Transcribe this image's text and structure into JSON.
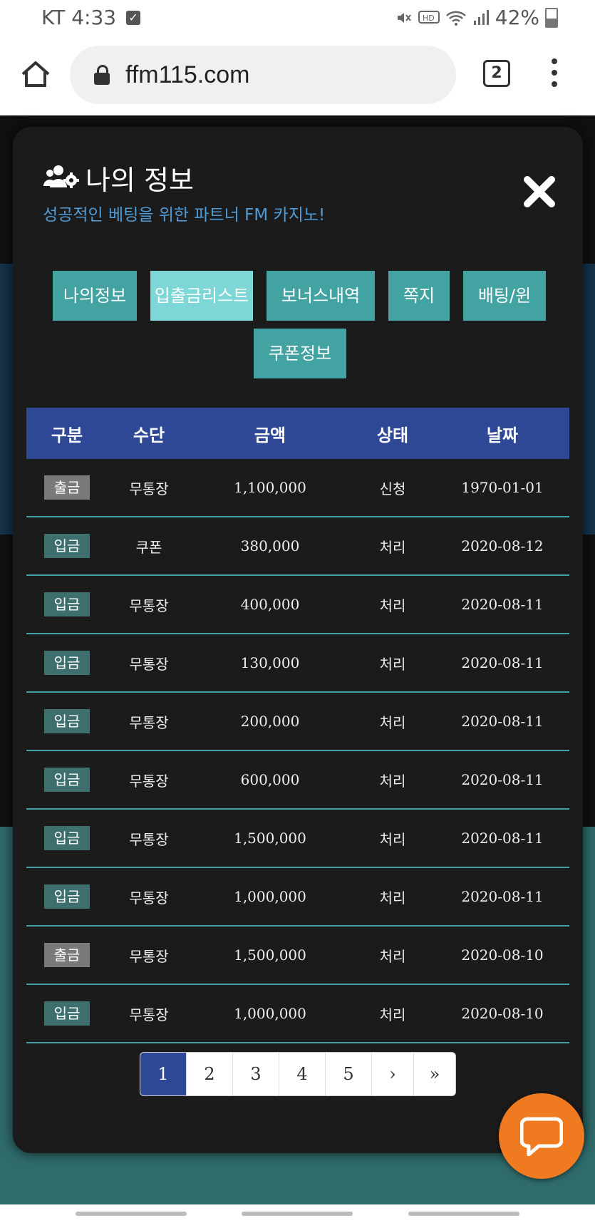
{
  "status_bar": {
    "carrier_time": "KT 4:33",
    "battery": "42%",
    "icons": [
      "check-icon",
      "mute-icon",
      "hd-icon",
      "wifi-icon",
      "signal-icon",
      "battery-icon"
    ]
  },
  "browser": {
    "url": "ffm115.com",
    "tab_count": "2",
    "icons": [
      "home-icon",
      "lock-icon",
      "tabs-icon",
      "menu-icon"
    ]
  },
  "modal": {
    "title": "나의 정보",
    "subtitle": "성공적인 베팅을 위한 파트너 FM 카지노!",
    "tabs": [
      {
        "label": "나의정보",
        "active": false
      },
      {
        "label": "입출금리스트",
        "active": true
      },
      {
        "label": "보너스내역",
        "active": false
      },
      {
        "label": "쪽지",
        "active": false
      },
      {
        "label": "배팅/윈",
        "active": false
      },
      {
        "label": "쿠폰정보",
        "active": false
      }
    ],
    "table": {
      "headers": [
        "구분",
        "수단",
        "금액",
        "상태",
        "날짜"
      ],
      "rows": [
        {
          "type": "출금",
          "method": "무통장",
          "amount": "1,100,000",
          "status": "신청",
          "date": "1970-01-01"
        },
        {
          "type": "입금",
          "method": "쿠폰",
          "amount": "380,000",
          "status": "처리",
          "date": "2020-08-12"
        },
        {
          "type": "입금",
          "method": "무통장",
          "amount": "400,000",
          "status": "처리",
          "date": "2020-08-11"
        },
        {
          "type": "입금",
          "method": "무통장",
          "amount": "130,000",
          "status": "처리",
          "date": "2020-08-11"
        },
        {
          "type": "입금",
          "method": "무통장",
          "amount": "200,000",
          "status": "처리",
          "date": "2020-08-11"
        },
        {
          "type": "입금",
          "method": "무통장",
          "amount": "600,000",
          "status": "처리",
          "date": "2020-08-11"
        },
        {
          "type": "입금",
          "method": "무통장",
          "amount": "1,500,000",
          "status": "처리",
          "date": "2020-08-11"
        },
        {
          "type": "입금",
          "method": "무통장",
          "amount": "1,000,000",
          "status": "처리",
          "date": "2020-08-11"
        },
        {
          "type": "출금",
          "method": "무통장",
          "amount": "1,500,000",
          "status": "처리",
          "date": "2020-08-10"
        },
        {
          "type": "입금",
          "method": "무통장",
          "amount": "1,000,000",
          "status": "처리",
          "date": "2020-08-10"
        }
      ]
    },
    "pagination": {
      "pages": [
        "1",
        "2",
        "3",
        "4",
        "5"
      ],
      "current": "1",
      "next": "›",
      "last": "»"
    }
  },
  "colors": {
    "header_blue": "#2e4896",
    "tab_teal": "#43a3a2",
    "tab_active": "#7ed7d7",
    "subtitle_blue": "#4f9bd6",
    "chat_orange": "#f07a1f"
  }
}
